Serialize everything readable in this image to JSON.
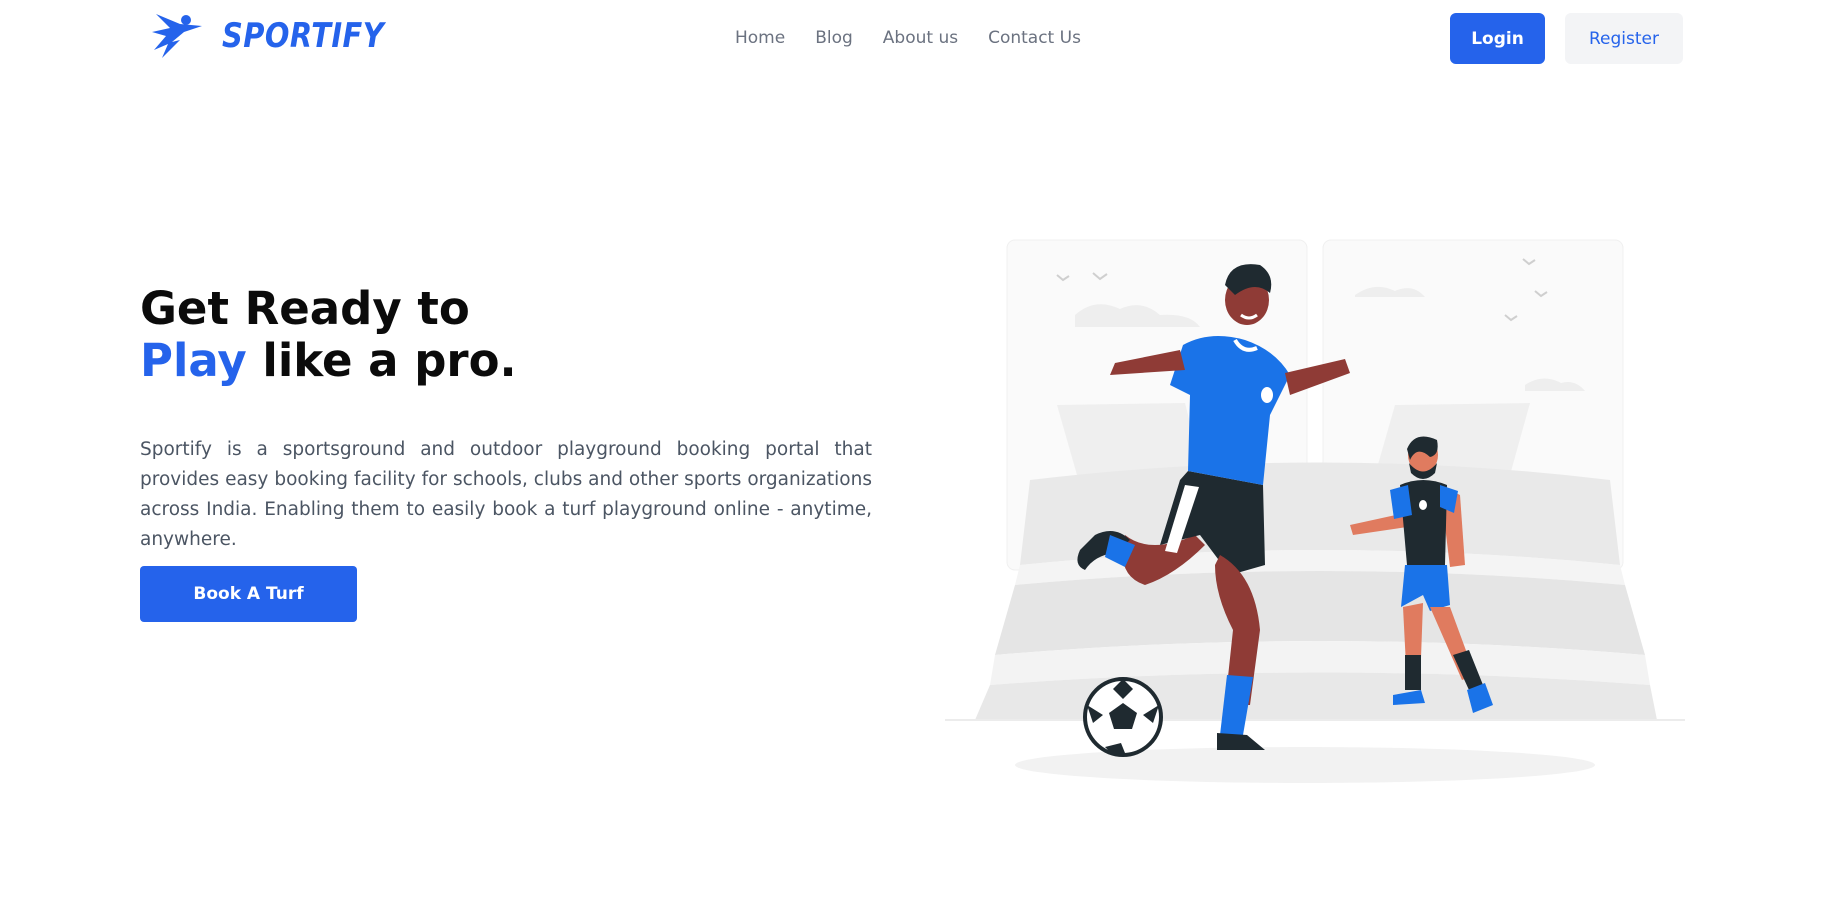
{
  "brand": {
    "name": "SPORTIFY",
    "color": "#2563eb"
  },
  "nav": {
    "items": [
      {
        "label": "Home"
      },
      {
        "label": "Blog"
      },
      {
        "label": "About us"
      },
      {
        "label": "Contact Us"
      }
    ]
  },
  "auth": {
    "login_label": "Login",
    "register_label": "Register"
  },
  "hero": {
    "title_line1": "Get Ready to",
    "title_accent": "Play",
    "title_rest": "like a pro.",
    "description": "Sportify is a sportsground and outdoor playground booking portal that provides easy booking facility for schools, clubs and other sports organizations across India. Enabling them to easily book a turf playground online - anytime, anywhere.",
    "cta_label": "Book A Turf"
  },
  "illustration": {
    "subject": "football-players-icon"
  },
  "colors": {
    "accent": "#2563eb",
    "text_muted": "#4b5563",
    "nav_text": "#6b7280"
  }
}
